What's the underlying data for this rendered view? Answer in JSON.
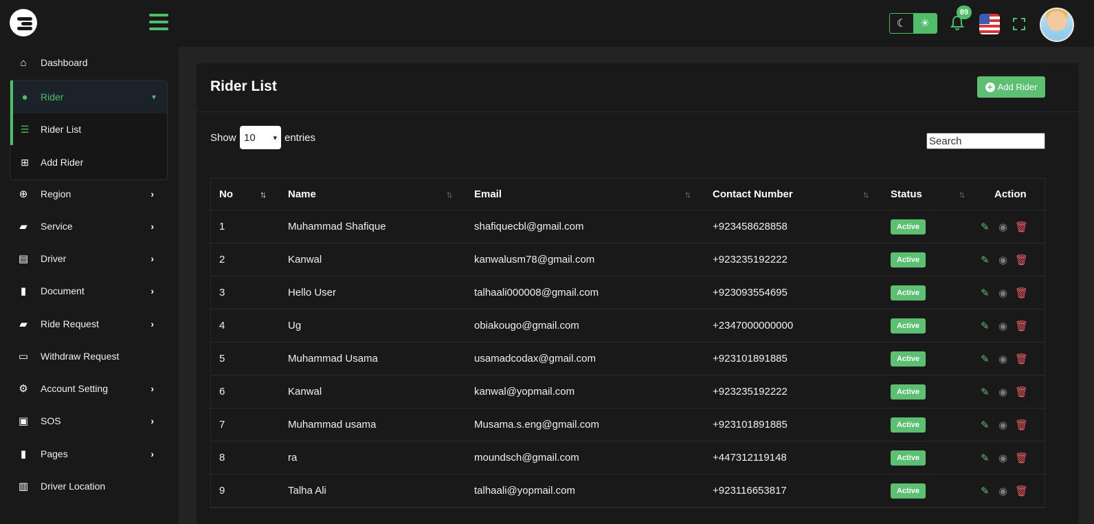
{
  "topbar": {
    "notification_count": "89",
    "colors": {
      "accent": "#4fbd6a",
      "background": "#191919"
    }
  },
  "sidebar": {
    "items": [
      {
        "label": "Dashboard",
        "icon": "home-icon"
      },
      {
        "label": "Rider",
        "icon": "user-icon"
      },
      {
        "label": "Region",
        "icon": "globe-icon"
      },
      {
        "label": "Service",
        "icon": "car-icon"
      },
      {
        "label": "Driver",
        "icon": "id-card-icon"
      },
      {
        "label": "Document",
        "icon": "file-icon"
      },
      {
        "label": "Ride Request",
        "icon": "car-side-icon"
      },
      {
        "label": "Withdraw Request",
        "icon": "money-check-icon"
      },
      {
        "label": "Account Setting",
        "icon": "users-cog-icon"
      },
      {
        "label": "SOS",
        "icon": "address-book-icon"
      },
      {
        "label": "Pages",
        "icon": "file-icon"
      },
      {
        "label": "Driver Location",
        "icon": "map-icon"
      }
    ],
    "rider_submenu": [
      {
        "label": "Rider List",
        "icon": "list-icon"
      },
      {
        "label": "Add Rider",
        "icon": "plus-square-icon"
      }
    ]
  },
  "main": {
    "title": "Rider List",
    "add_button_label": "Add Rider",
    "show_label": "Show",
    "entries_label": "entries",
    "entries_selected": "10",
    "search_placeholder": "Search",
    "columns": [
      "No",
      "Name",
      "Email",
      "Contact Number",
      "Status",
      "Action"
    ],
    "rows": [
      {
        "no": "1",
        "name": "Muhammad Shafique",
        "email": "shafiquecbl@gmail.com",
        "contact": "+923458628858",
        "status": "Active"
      },
      {
        "no": "2",
        "name": "Kanwal",
        "email": "kanwalusm78@gmail.com",
        "contact": "+923235192222",
        "status": "Active"
      },
      {
        "no": "3",
        "name": "Hello User",
        "email": "talhaali000008@gmail.com",
        "contact": "+923093554695",
        "status": "Active"
      },
      {
        "no": "4",
        "name": "Ug",
        "email": "obiakougo@gmail.com",
        "contact": "+2347000000000",
        "status": "Active"
      },
      {
        "no": "5",
        "name": "Muhammad Usama",
        "email": "usamadcodax@gmail.com",
        "contact": "+923101891885",
        "status": "Active"
      },
      {
        "no": "6",
        "name": "Kanwal",
        "email": "kanwal@yopmail.com",
        "contact": "+923235192222",
        "status": "Active"
      },
      {
        "no": "7",
        "name": "Muhammad usama",
        "email": "Musama.s.eng@gmail.com",
        "contact": "+923101891885",
        "status": "Active"
      },
      {
        "no": "8",
        "name": "ra",
        "email": "moundsch@gmail.com",
        "contact": "+447312119148",
        "status": "Active"
      },
      {
        "no": "9",
        "name": "Talha Ali",
        "email": "talhaali@yopmail.com",
        "contact": "+923116653817",
        "status": "Active"
      }
    ],
    "colors": {
      "status_active": "#5cbf71",
      "edit": "#5cbf71",
      "delete": "#ef5b67"
    }
  }
}
